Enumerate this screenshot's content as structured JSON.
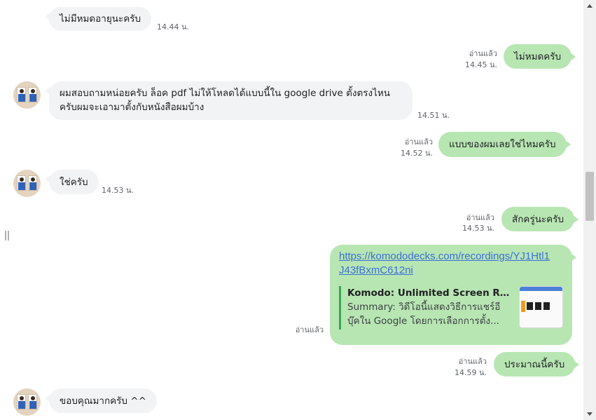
{
  "messages": [
    {
      "text": "ไม่มีหมดอายุนะครับ",
      "time": "14.44 น."
    },
    {
      "text": "ไม่หมดครับ",
      "status": "อ่านแล้ว",
      "time": "14.45 น."
    },
    {
      "line1": "ผมสอบถามหน่อยครับ ล็อค pdf ไม่ให้โหลดได้แบบนี้ใน google drive ตั้งตรงไหน",
      "line2": "ครับผมจะเอามาตั้งกับหนังสือผมบ้าง",
      "time": "14.51 น."
    },
    {
      "text": "แบบของผมเลยใช่ไหมครับ",
      "status": "อ่านแล้ว",
      "time": "14.52 น."
    },
    {
      "text": "ใช่ครับ",
      "time": "14.53 น."
    },
    {
      "text": "สักครู่นะครับ",
      "status": "อ่านแล้ว",
      "time": "14.53 น."
    },
    {
      "url_line1": "https://komododecks.com/recordings/YJ1Htl1",
      "url_line2": "J43fBxmC612ni",
      "preview_title": "Komodo: Unlimited Screen Recording",
      "preview_summary_line1": "Summary: วิดีโอนี้แสดงวิธีการแชร์อี",
      "preview_summary_line2": "บุ๊คใน Google โดยการเลือกการตั้ง...",
      "status": "อ่านแล้ว"
    },
    {
      "text": "ประมาณนี้ครับ",
      "status": "อ่านแล้ว",
      "time": "14.59 น."
    },
    {
      "text": "ขอบคุณมากครับ ^^"
    }
  ],
  "icons": {
    "avatar": "contact-avatar",
    "scroll_up": "chevron-up-icon",
    "scroll_down": "chevron-down-icon",
    "resize": "resize-handle-icon"
  },
  "colors": {
    "incoming_bubble": "#f1f3f4",
    "outgoing_bubble": "#b8e6b3",
    "link": "#3b6fd6",
    "preview_border": "#34a853"
  }
}
